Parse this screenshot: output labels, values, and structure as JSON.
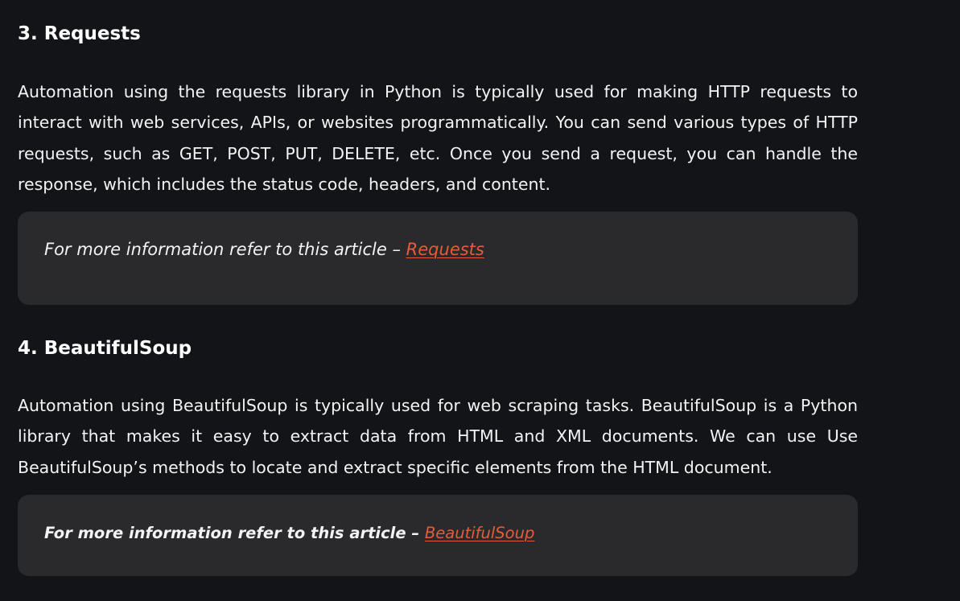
{
  "sections": [
    {
      "heading": "3. Requests",
      "paragraph": "Automation using the requests library in Python is typically used for making HTTP requests to interact with web services, APIs, or websites programmatically. You can send various types of HTTP requests, such as GET, POST, PUT, DELETE, etc. Once you send a request, you can handle the response, which includes the status code, headers, and content.",
      "callout": {
        "prefix": "For more information refer to this article – ",
        "link_text": "Requests"
      }
    },
    {
      "heading": "4. BeautifulSoup",
      "paragraph": "Automation using BeautifulSoup is typically used for web scraping tasks. BeautifulSoup is a Python library that makes it easy to extract data from HTML and XML documents. We can use Use BeautifulSoup’s methods to locate and extract specific elements from the HTML document.",
      "callout": {
        "prefix": "For more information refer to this article – ",
        "link_text": "BeautifulSoup"
      }
    }
  ],
  "colors": {
    "background": "#131417",
    "callout_background": "#2a2a2d",
    "link": "#e65c3a"
  }
}
